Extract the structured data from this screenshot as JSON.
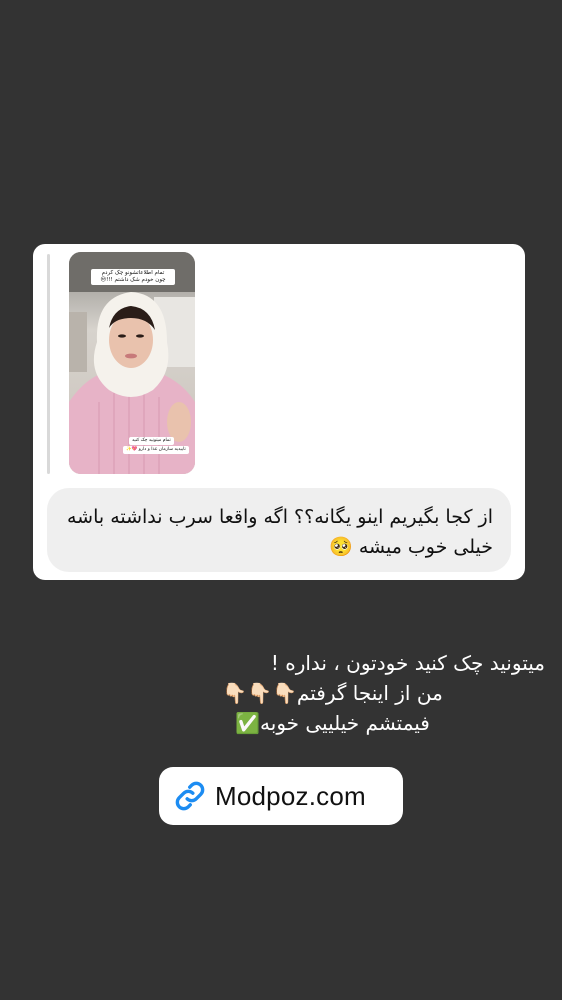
{
  "story_thumbnail": {
    "caption_top": "تمام اطلاعاتشونو چک کردم\nچون خودم شک داشتم !!!😒",
    "sticker_a": "تمام میتونید چک کنید",
    "sticker_b": "تاییدیه سازمان غذا و دارو 💖✨"
  },
  "message": {
    "text": "از کجا بگیریم اینو یگانه؟؟ اگه واقعا سرب نداشته باشه خیلی خوب میشه 🥺"
  },
  "caption": {
    "line1": "میتونید چک کنید خودتون ، نداره !",
    "line2": "من از اینجا گرفتم👇🏻👇🏻👇🏻",
    "line3": "فیمتشم خیلییی خوبه✅"
  },
  "link_sticker": {
    "icon": "link-icon",
    "label": "Modpoz.com",
    "accent_color": "#1c8cf2"
  },
  "colors": {
    "background": "#333333",
    "card": "#ffffff",
    "bubble": "#efefef"
  }
}
